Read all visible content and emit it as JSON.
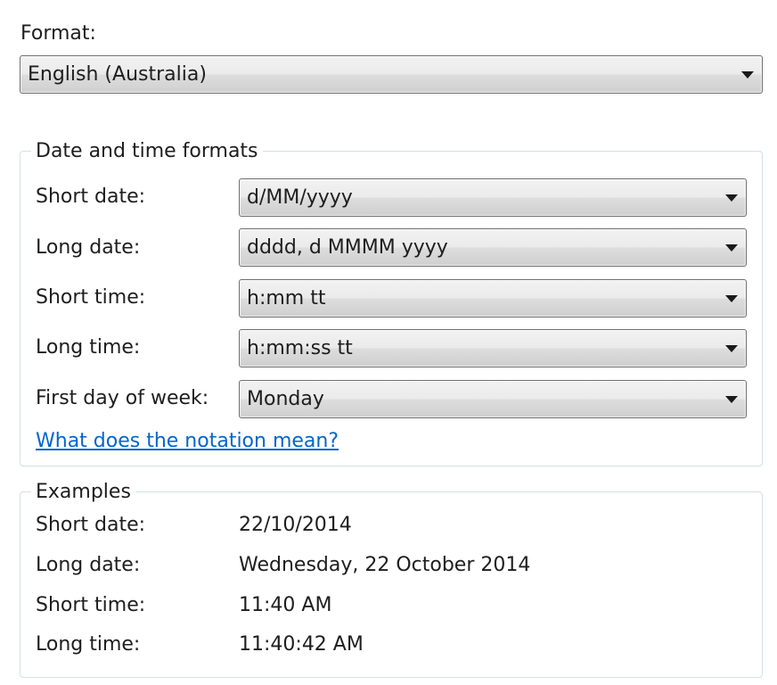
{
  "format": {
    "label": "Format:",
    "selected": "English (Australia)"
  },
  "date_time_formats": {
    "title": "Date and time formats",
    "rows": [
      {
        "label": "Short date:",
        "value": "d/MM/yyyy"
      },
      {
        "label": "Long date:",
        "value": "dddd, d MMMM yyyy"
      },
      {
        "label": "Short time:",
        "value": "h:mm tt"
      },
      {
        "label": "Long time:",
        "value": "h:mm:ss tt"
      },
      {
        "label": "First day of week:",
        "value": "Monday"
      }
    ],
    "notation_link": "What does the notation mean?"
  },
  "examples": {
    "title": "Examples",
    "rows": [
      {
        "label": "Short date:",
        "value": "22/10/2014"
      },
      {
        "label": "Long date:",
        "value": "Wednesday, 22 October 2014"
      },
      {
        "label": "Short time:",
        "value": "11:40 AM"
      },
      {
        "label": "Long time:",
        "value": "11:40:42 AM"
      }
    ]
  },
  "icons": {
    "dropdown": "chevron-down-icon"
  }
}
